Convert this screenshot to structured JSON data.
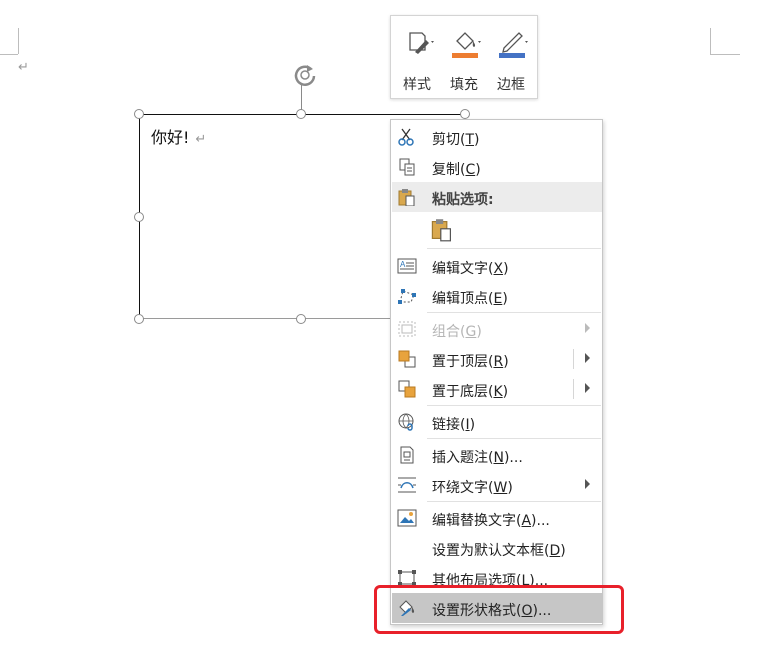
{
  "document": {
    "paragraph_mark": "↵",
    "textbox_text": "你好!",
    "textbox_mark": "↵"
  },
  "mini_toolbar": {
    "style_label": "样式",
    "fill_label": "填充",
    "border_label": "边框"
  },
  "context_menu": {
    "items": [
      {
        "label": "剪切(",
        "key": "T",
        "suffix": ")",
        "icon": "scissors-icon"
      },
      {
        "label": "复制(",
        "key": "C",
        "suffix": ")",
        "icon": "copy-icon"
      },
      {
        "label": "粘贴选项:",
        "icon": "paste-icon"
      },
      {
        "label": "",
        "icon": "paste-keep-icon"
      },
      {
        "label": "编辑文字(",
        "key": "X",
        "suffix": ")",
        "icon": "edit-text-icon"
      },
      {
        "label": "编辑顶点(",
        "key": "E",
        "suffix": ")",
        "icon": "edit-points-icon"
      },
      {
        "label": "组合(",
        "key": "G",
        "suffix": ")",
        "icon": "group-icon",
        "disabled": true
      },
      {
        "label": "置于顶层(",
        "key": "R",
        "suffix": ")",
        "icon": "bring-front-icon"
      },
      {
        "label": "置于底层(",
        "key": "K",
        "suffix": ")",
        "icon": "send-back-icon"
      },
      {
        "label": "链接(",
        "key": "I",
        "suffix": ")",
        "icon": "link-icon"
      },
      {
        "label": "插入题注(",
        "key": "N",
        "suffix": ")...",
        "icon": "caption-icon"
      },
      {
        "label": "环绕文字(",
        "key": "W",
        "suffix": ")",
        "icon": "wrap-text-icon"
      },
      {
        "label": "编辑替换文字(",
        "key": "A",
        "suffix": ")...",
        "icon": "alt-text-icon"
      },
      {
        "label": "设置为默认文本框(",
        "key": "D",
        "suffix": ")",
        "icon": ""
      },
      {
        "label": "其他布局选项(",
        "key": "L",
        "suffix": ")...",
        "icon": "layout-options-icon"
      },
      {
        "label": "设置形状格式(",
        "key": "O",
        "suffix": ")...",
        "icon": "format-shape-icon"
      }
    ]
  },
  "colors": {
    "fill_accent": "#ed7d31",
    "border_accent": "#4472c4",
    "highlight_box": "#e8202a"
  }
}
